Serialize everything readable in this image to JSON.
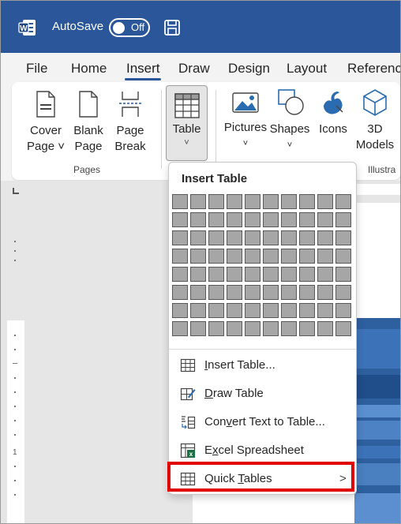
{
  "titlebar": {
    "autosave_label": "AutoSave",
    "toggle_state": "Off"
  },
  "tabs": [
    {
      "label": "File"
    },
    {
      "label": "Home"
    },
    {
      "label": "Insert"
    },
    {
      "label": "Draw"
    },
    {
      "label": "Design"
    },
    {
      "label": "Layout"
    },
    {
      "label": "Referenc"
    }
  ],
  "ribbon": {
    "cover_page": [
      "Cover",
      "Page ˅"
    ],
    "blank_page": [
      "Blank",
      "Page"
    ],
    "page_break": [
      "Page",
      "Break"
    ],
    "pages_group": "Pages",
    "table": "Table",
    "pictures": "Pictures",
    "shapes": "Shapes",
    "icons": "Icons",
    "models": [
      "3D",
      "Models"
    ],
    "illustrations_group": "Illustra"
  },
  "dropdown": {
    "title": "Insert Table",
    "grid": {
      "cols": 10,
      "rows": 8
    },
    "items": [
      {
        "label": "Insert Table...",
        "underline": "I"
      },
      {
        "label": "Draw Table",
        "underline": "D"
      },
      {
        "label": "Convert Text to Table...",
        "underline": "v"
      },
      {
        "label": "Excel Spreadsheet",
        "underline": "x"
      },
      {
        "label": "Quick Tables",
        "underline": "T",
        "chevron": ">"
      }
    ]
  },
  "ruler": {
    "mark": "1"
  },
  "colors": {
    "titlebar": "#2b579a",
    "highlight": "#e00000"
  }
}
